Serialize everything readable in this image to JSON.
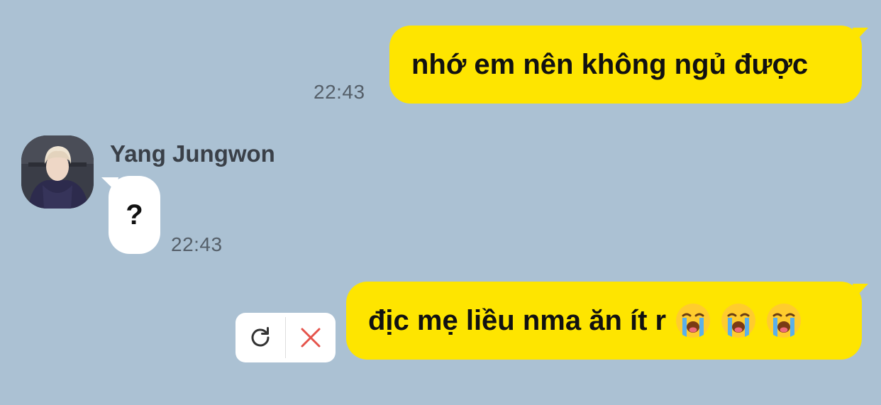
{
  "messages": [
    {
      "direction": "outgoing",
      "text": "nhớ em nên không ngủ được",
      "time": "22:43"
    },
    {
      "direction": "incoming",
      "sender": "Yang Jungwon",
      "text": "?",
      "time": "22:43"
    },
    {
      "direction": "outgoing",
      "text": "địc mẹ liều nma ăn ít r",
      "emojis": [
        "loudly-crying-face",
        "loudly-crying-face",
        "loudly-crying-face"
      ],
      "status": "failed"
    }
  ],
  "failed_actions": {
    "retry_icon": "retry-icon",
    "delete_icon": "close-icon"
  },
  "colors": {
    "background": "#abc1d3",
    "outgoing_bubble": "#fee500",
    "incoming_bubble": "#ffffff",
    "delete_icon": "#e5534b"
  }
}
